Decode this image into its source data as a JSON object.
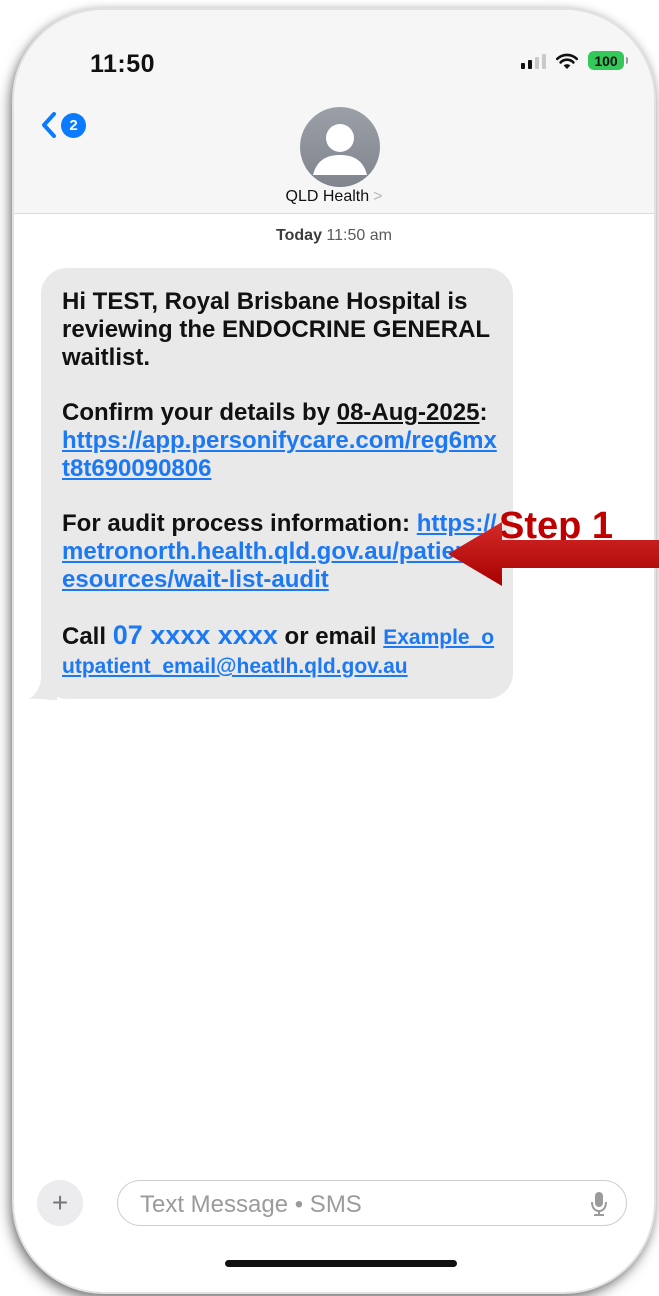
{
  "status_bar": {
    "time": "11:50",
    "battery": "100"
  },
  "header": {
    "back_badge": "2",
    "contact_name": "QLD Health",
    "contact_chevron": ">"
  },
  "thread": {
    "timestamp_day": "Today",
    "timestamp_time": "11:50 am"
  },
  "message": {
    "p1": "Hi TEST, Royal Brisbane Hospital is reviewing the ENDOCRINE GENERAL waitlist.",
    "p2_prefix": "Confirm your details by ",
    "p2_date": "08-Aug-2025",
    "p2_colon": ": ",
    "p2_link": "https://app.personifycare.com/reg6mxt8t690090806",
    "p3_prefix": "For audit process information: ",
    "p3_link": "https://metronorth.health.qld.gov.au/patient-resources/wait-list-audit",
    "p4_prefix": "Call ",
    "p4_phone": "07 xxxx xxxx",
    "p4_middle": " or email ",
    "p4_email": "Example_outpatient_email@heatlh.qld.gov.au"
  },
  "annotation": {
    "label": "Step 1",
    "color": "#c00000"
  },
  "composer": {
    "placeholder": "Text Message • SMS"
  },
  "colors": {
    "link": "#1c79f3",
    "bubble": "#e9e9ea",
    "badge": "#0a7bfe",
    "battery": "#34c759"
  }
}
